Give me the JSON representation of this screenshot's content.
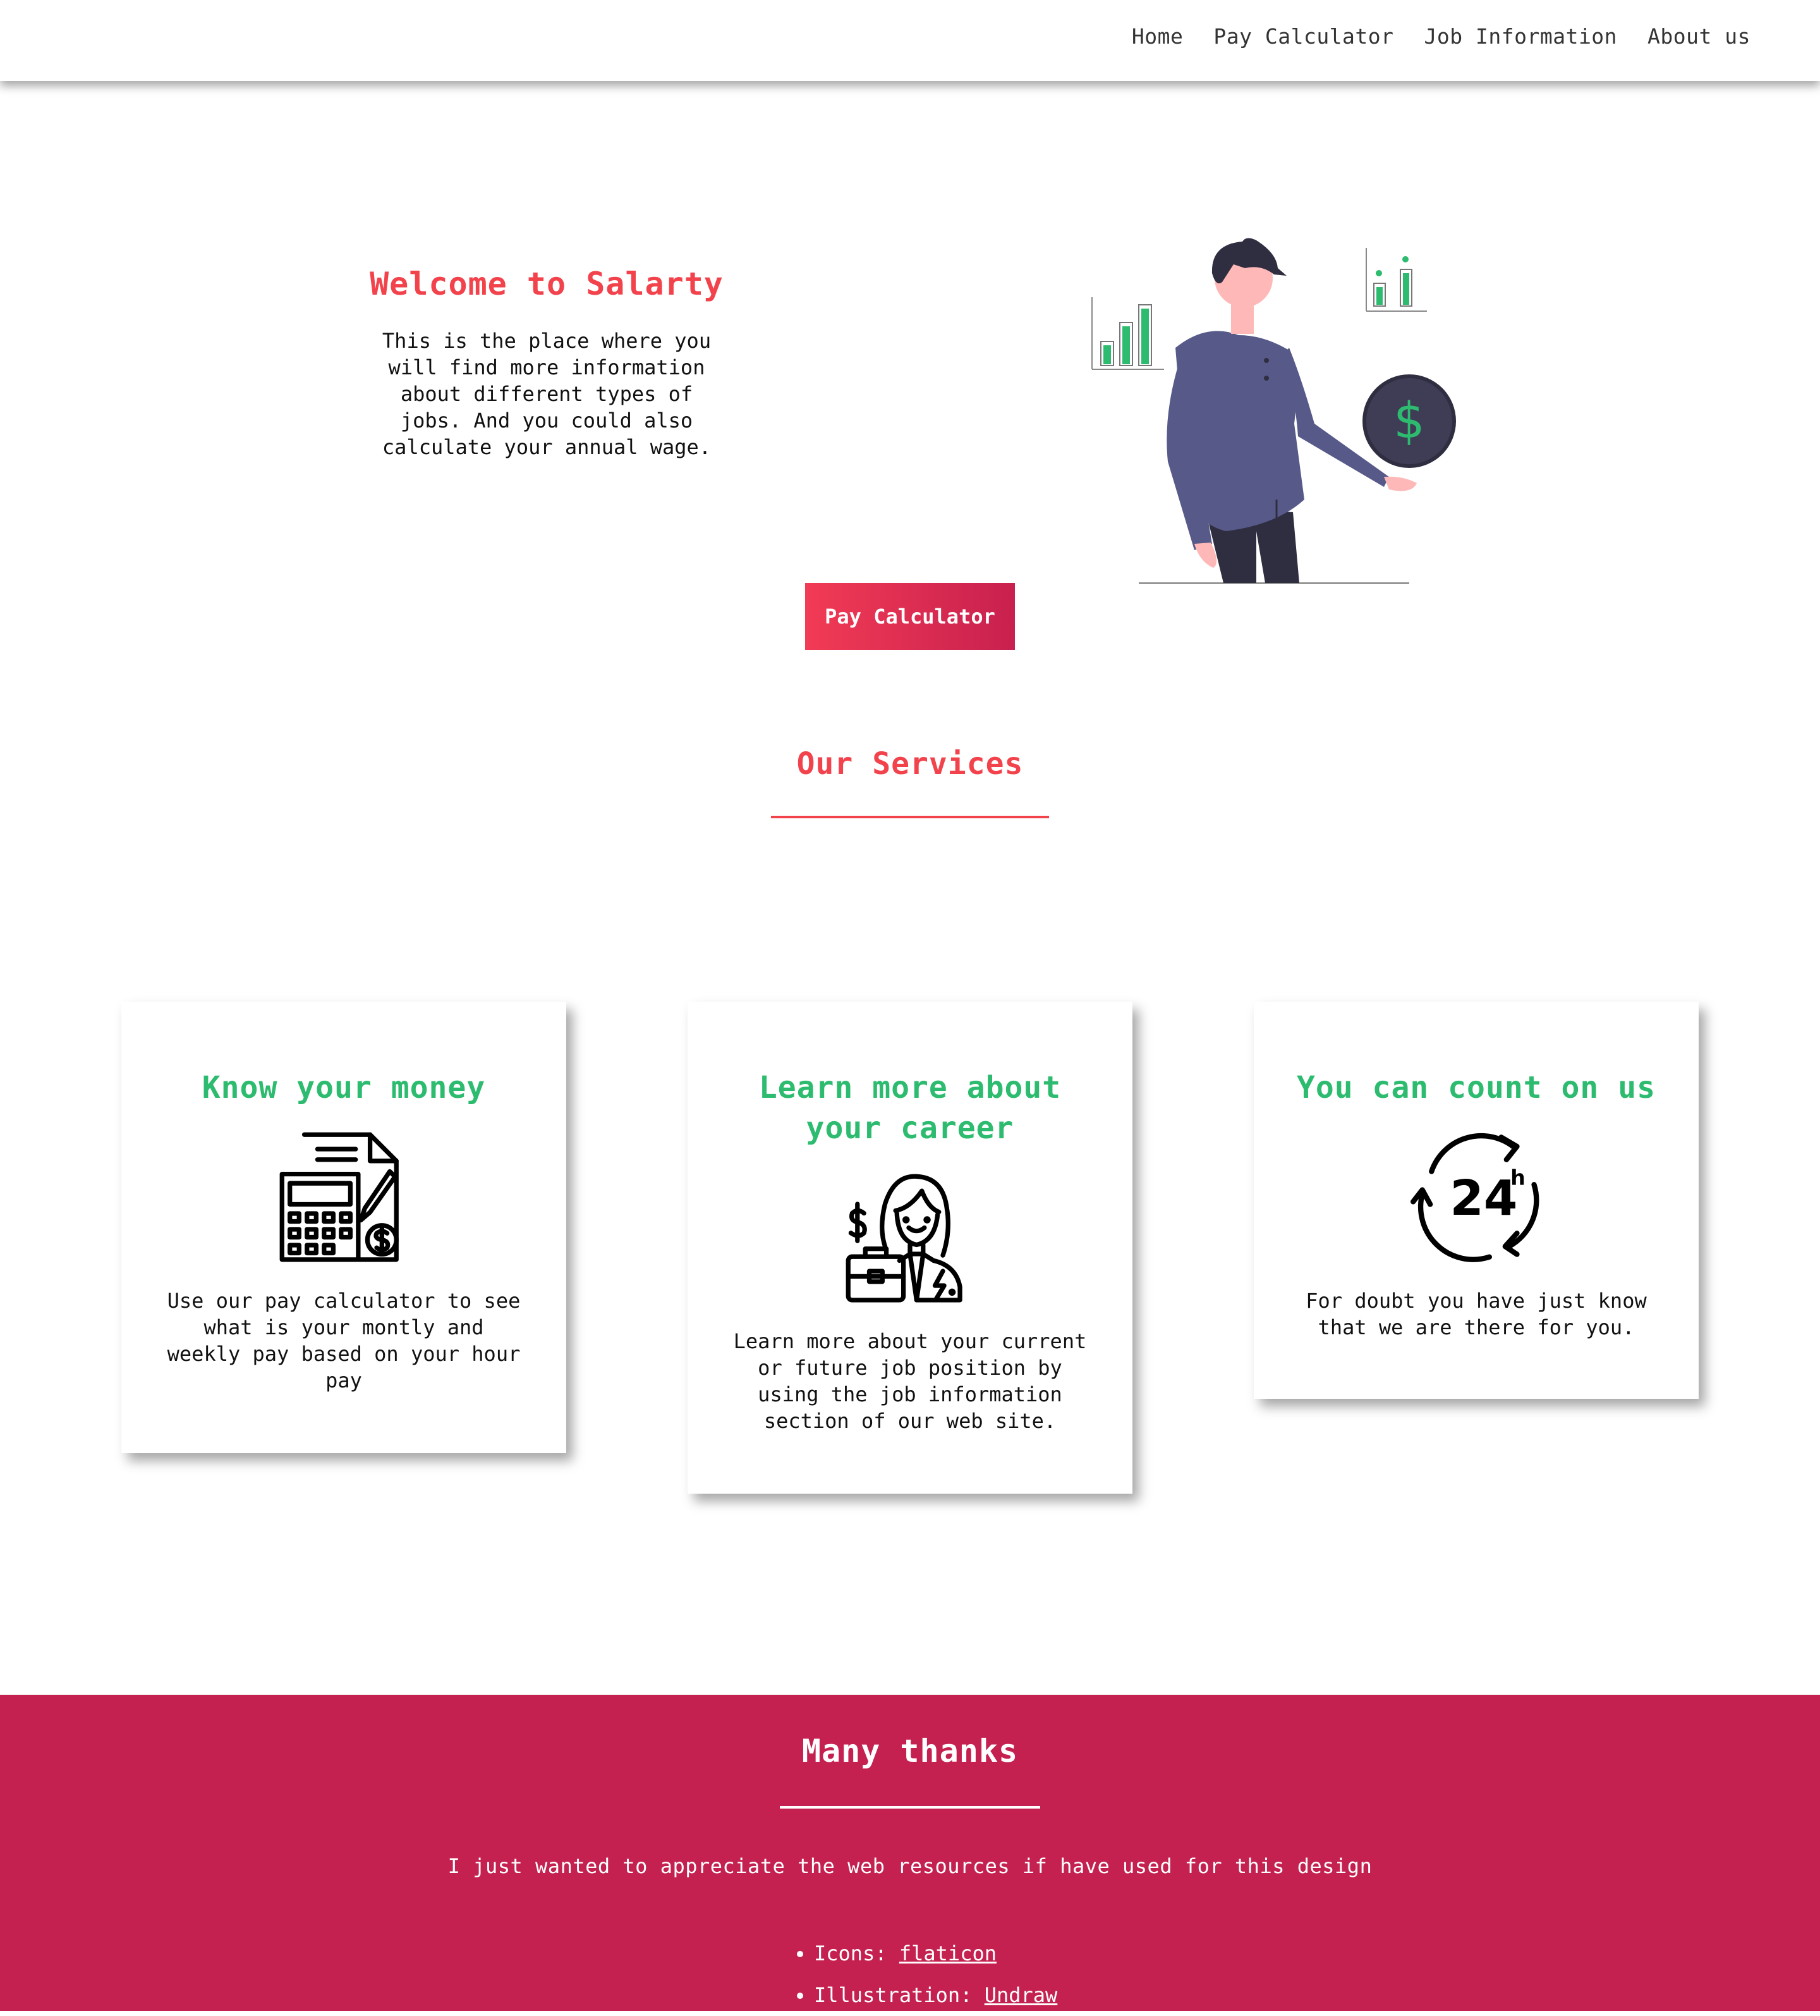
{
  "nav": {
    "items": [
      {
        "label": "Home"
      },
      {
        "label": "Pay Calculator"
      },
      {
        "label": "Job Information"
      },
      {
        "label": "About us"
      }
    ]
  },
  "hero": {
    "title": "Welcome to Salarty",
    "description": "This is the place where you will find more information about different types of jobs. And you could also calculate your annual wage.",
    "button_label": "Pay Calculator",
    "dollar_symbol": "$"
  },
  "services": {
    "title": "Our Services",
    "cards": [
      {
        "title": "Know your money",
        "icon": "calculator-icon",
        "text": "Use our pay calculator to see what is your montly and weekly pay based on your hour pay"
      },
      {
        "title": "Learn more about your career",
        "icon": "businesswoman-icon",
        "text": "Learn more about your current or future job position by using the job information section of our web site."
      },
      {
        "title": "You can count on us",
        "icon": "24h-support-icon",
        "text": "For doubt you have just know that we are there for you.",
        "icon_text": "24",
        "icon_sup": "h"
      }
    ]
  },
  "footer": {
    "title": "Many thanks",
    "text": "I just wanted to appreciate the web resources if have used for this design",
    "credits": [
      {
        "label": "Icons: ",
        "link": "flaticon"
      },
      {
        "label": "Illustration: ",
        "link": "Undraw"
      }
    ]
  },
  "colors": {
    "accent_red": "#f2434c",
    "accent_green": "#2dbb6f",
    "footer_bg": "#c42150",
    "illustration_shirt": "#575a89"
  }
}
